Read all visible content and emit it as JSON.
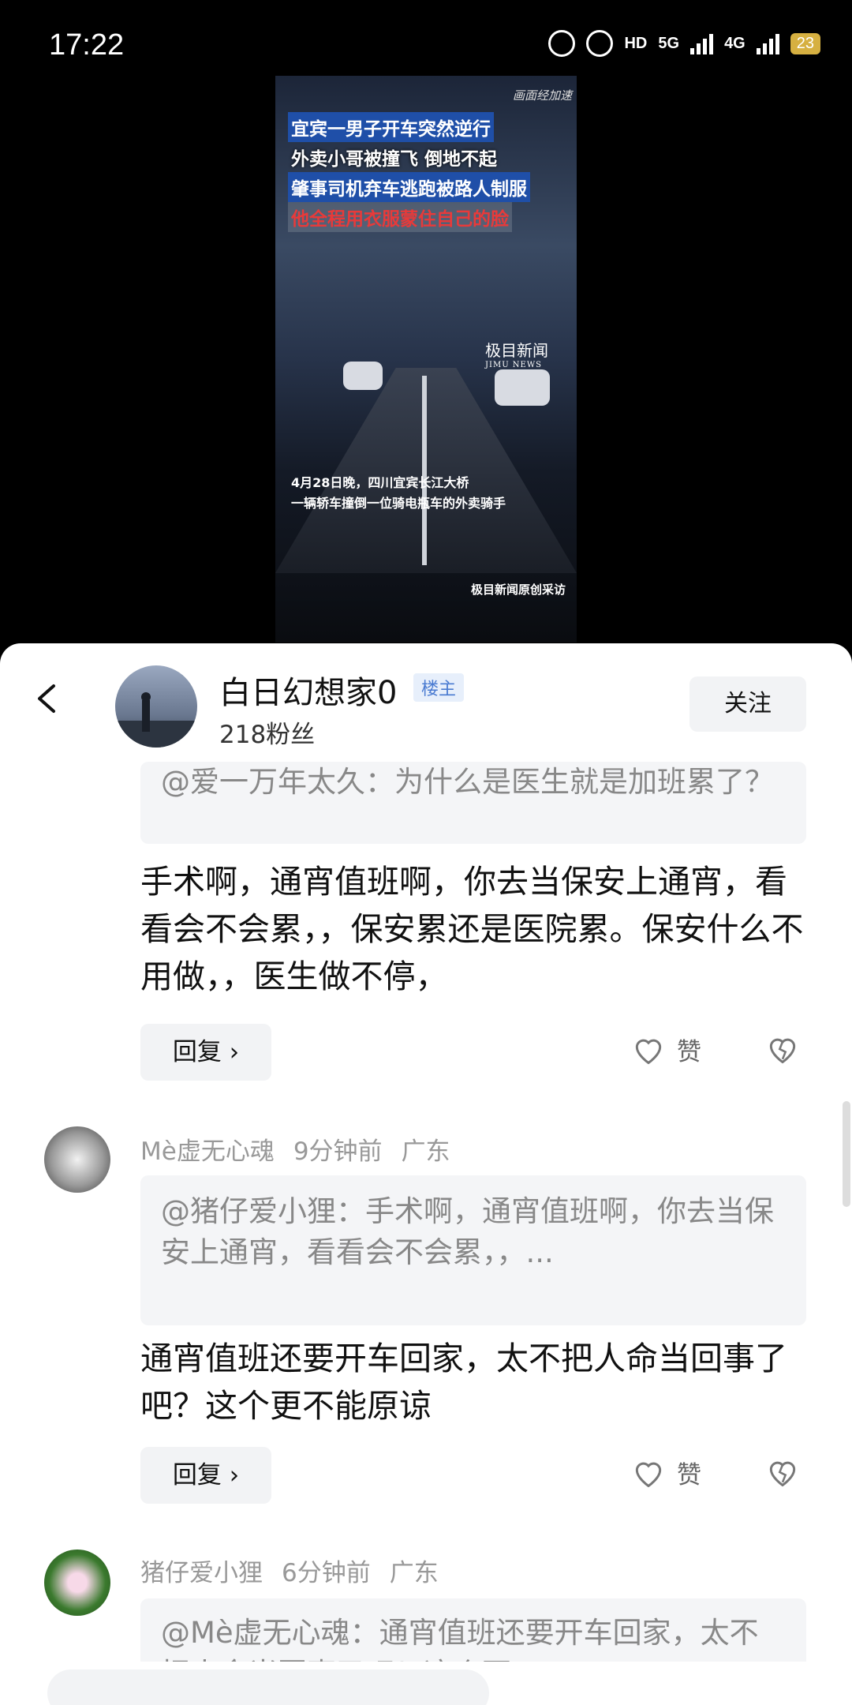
{
  "status": {
    "time": "17:22",
    "net1": "HD",
    "net2": "5G",
    "net3": "4G",
    "battery": "23"
  },
  "video": {
    "speed_note": "画面经加速",
    "headlines": [
      "宜宾一男子开车突然逆行",
      "外卖小哥被撞飞 倒地不起",
      "肇事司机弃车逃跑被路人制服",
      "他全程用衣服蒙住自己的脸"
    ],
    "logo": "极目新闻",
    "logo_sub": "JIMU NEWS",
    "caption1": "4月28日晚，四川宜宾长江大桥",
    "caption2": "一辆轿车撞倒一位骑电瓶车的外卖骑手",
    "source": "极目新闻原创采访"
  },
  "header": {
    "name": "白日幻想家0",
    "badge": "楼主",
    "fans": "218粉丝",
    "follow": "关注"
  },
  "comments": [
    {
      "quote": "@爱一万年太久：为什么是医生就是加班累了？",
      "body": "手术啊，通宵值班啊，你去当保安上通宵，看看会不会累，，保安累还是医院累。保安什么不用做，，医生做不停，",
      "reply": "回复 ›",
      "like": "赞"
    },
    {
      "user": "Mè虚无心魂",
      "time": "9分钟前",
      "location": "广东",
      "quote": "@猪仔爱小狸：手术啊，通宵值班啊，你去当保安上通宵，看看会不会累，，...",
      "body": "通宵值班还要开车回家，太不把人命当回事了吧？这个更不能原谅",
      "reply": "回复 ›",
      "like": "赞"
    },
    {
      "user": "猪仔爱小狸",
      "time": "6分钟前",
      "location": "广东",
      "quote": "@Mè虚无心魂：通宵值班还要开车回家，太不把人命当回事了吧？这个更"
    }
  ],
  "colors": {
    "accent": "#4a7bd1",
    "quote_bg": "#f4f5f7",
    "button_bg": "#f2f3f5"
  }
}
